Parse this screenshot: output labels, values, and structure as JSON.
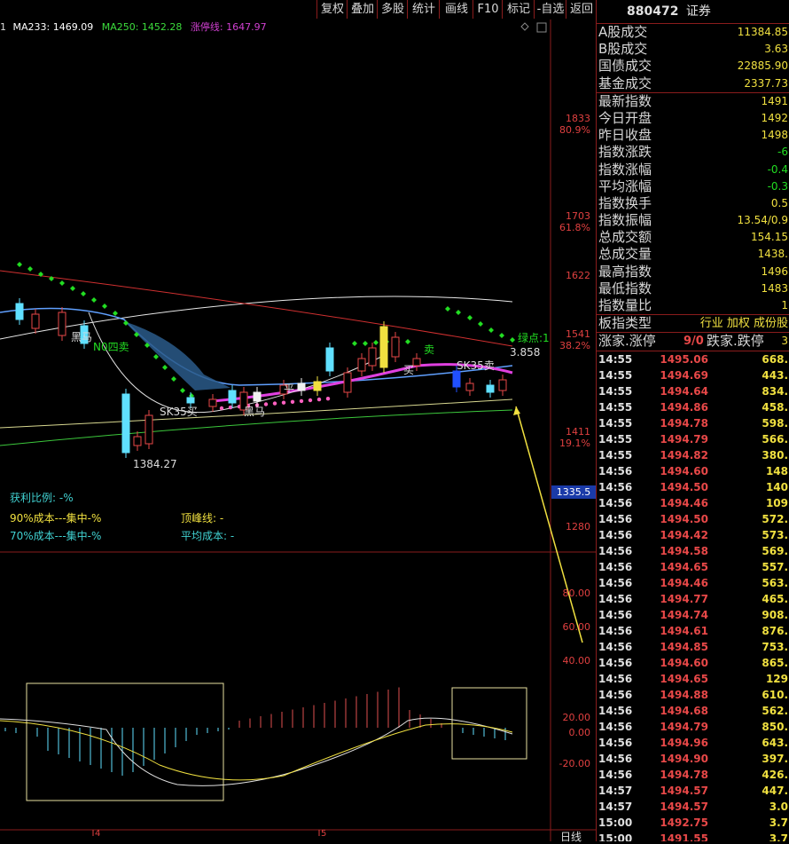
{
  "toolbar": [
    "复权",
    "叠加",
    "多股",
    "统计",
    "画线",
    "F10",
    "标记",
    "-自选",
    "返回"
  ],
  "ma_line": {
    "prefix": "1",
    "ma233": "MA233: 1469.09",
    "ma250": "MA250: 1452.28",
    "limit": "涨停线: 1647.97"
  },
  "price_axis": [
    {
      "price": "1833",
      "pct": "80.9%"
    },
    {
      "price": "1703",
      "pct": "61.8%"
    },
    {
      "price": "1622",
      "pct": ""
    },
    {
      "price": "1541",
      "pct": "38.2%"
    },
    {
      "price": "1411",
      "pct": "19.1%"
    },
    {
      "price": "1280",
      "pct": ""
    }
  ],
  "current_price_tag": "1335.5",
  "chart_labels": {
    "low": "1384.27",
    "last": "3.858",
    "green_pt": "绿点:1",
    "sk_left": "SK35买",
    "sk_right": "SK35卖",
    "sell": "N0四卖",
    "heima": "黑马",
    "heima2": "黑马",
    "buy": "买",
    "ping": "平",
    "mai": "卖"
  },
  "cost_info": {
    "profit": "获利比例: -%",
    "c90": "90%成本---集中-%",
    "c70": "70%成本---集中-%",
    "peak": "顶峰线: -",
    "avg": "平均成本: -"
  },
  "macd_axis": [
    "80.00",
    "60.00",
    "40.00",
    "20.00",
    "0.00",
    "-20.00"
  ],
  "bottom": {
    "period": "日线",
    "m4": "4",
    "m5": "5"
  },
  "right_panel": {
    "code": "880472",
    "name": "证券",
    "stats1": [
      {
        "label": "A股成交",
        "value": "11384.85"
      },
      {
        "label": "B股成交",
        "value": "3.63"
      },
      {
        "label": "国债成交",
        "value": "22885.90"
      },
      {
        "label": "基金成交",
        "value": "2337.73"
      }
    ],
    "stats2": [
      {
        "label": "最新指数",
        "value": "1491"
      },
      {
        "label": "今日开盘",
        "value": "1492"
      },
      {
        "label": "昨日收盘",
        "value": "1498"
      },
      {
        "label": "指数涨跌",
        "value": "-6"
      },
      {
        "label": "指数涨幅",
        "value": "-0.4"
      },
      {
        "label": "平均涨幅",
        "value": "-0.3"
      },
      {
        "label": "指数换手",
        "value": "0.5"
      },
      {
        "label": "指数振幅",
        "value": "13.54/0.9"
      },
      {
        "label": "总成交额",
        "value": "154.15"
      },
      {
        "label": "总成交量",
        "value": "1438."
      },
      {
        "label": "最高指数",
        "value": "1496"
      },
      {
        "label": "最低指数",
        "value": "1483"
      },
      {
        "label": "指数量比",
        "value": "1"
      }
    ],
    "type_row": {
      "label": "板指类型",
      "value": "行业 加权 成份股"
    },
    "rise_row": {
      "l1": "涨家.涨停",
      "v": "9/0",
      "l2": "跌家.跌停",
      "v2": "3"
    },
    "ticks": [
      [
        "14:55",
        "1495.06",
        "668."
      ],
      [
        "14:55",
        "1494.69",
        "443."
      ],
      [
        "14:55",
        "1494.64",
        "834."
      ],
      [
        "14:55",
        "1494.86",
        "458."
      ],
      [
        "14:55",
        "1494.78",
        "598."
      ],
      [
        "14:55",
        "1494.79",
        "566."
      ],
      [
        "14:55",
        "1494.82",
        "380."
      ],
      [
        "14:56",
        "1494.60",
        "148"
      ],
      [
        "14:56",
        "1494.50",
        "140"
      ],
      [
        "14:56",
        "1494.46",
        "109"
      ],
      [
        "14:56",
        "1494.50",
        "572."
      ],
      [
        "14:56",
        "1494.42",
        "573."
      ],
      [
        "14:56",
        "1494.58",
        "569."
      ],
      [
        "14:56",
        "1494.65",
        "557."
      ],
      [
        "14:56",
        "1494.46",
        "563."
      ],
      [
        "14:56",
        "1494.77",
        "465."
      ],
      [
        "14:56",
        "1494.74",
        "908."
      ],
      [
        "14:56",
        "1494.61",
        "876."
      ],
      [
        "14:56",
        "1494.85",
        "753."
      ],
      [
        "14:56",
        "1494.60",
        "865."
      ],
      [
        "14:56",
        "1494.65",
        "129"
      ],
      [
        "14:56",
        "1494.88",
        "610."
      ],
      [
        "14:56",
        "1494.68",
        "562."
      ],
      [
        "14:56",
        "1494.79",
        "850."
      ],
      [
        "14:56",
        "1494.96",
        "643."
      ],
      [
        "14:56",
        "1494.90",
        "397."
      ],
      [
        "14:56",
        "1494.78",
        "426."
      ],
      [
        "14:57",
        "1494.57",
        "447."
      ],
      [
        "14:57",
        "1494.57",
        "3.0"
      ],
      [
        "15:00",
        "1492.75",
        "3.7"
      ],
      [
        "15:00",
        "1491.55",
        "3.7"
      ]
    ]
  },
  "colors": {
    "axis_red": "#e04040",
    "price_up": "#e84848",
    "value_yellow": "#f0e040",
    "border": "#8a1c1c"
  }
}
